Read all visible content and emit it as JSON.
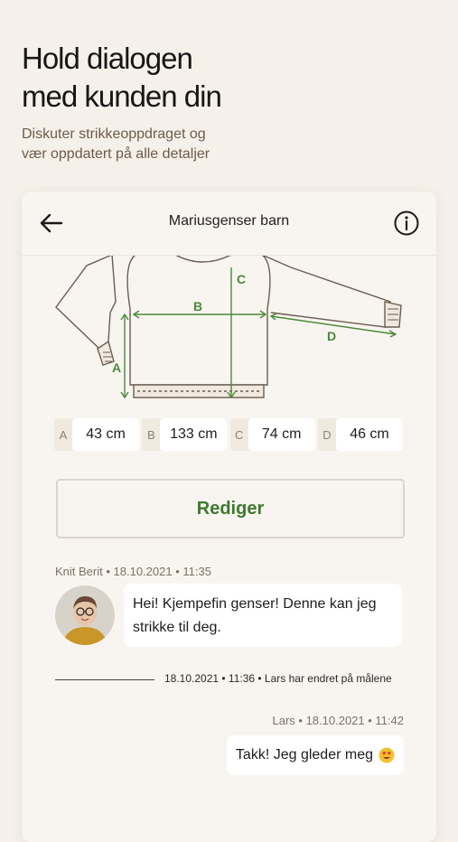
{
  "hero": {
    "title_line1": "Hold dialogen",
    "title_line2": "med kunden din",
    "subtitle_line1": "Diskuter strikkeoppdraget og",
    "subtitle_line2": "vær oppdatert på alle detaljer"
  },
  "header": {
    "back_icon": "arrow-left-icon",
    "title": "Mariusgenser barn",
    "info_icon": "info-icon"
  },
  "diagram": {
    "labels": {
      "a": "A",
      "b": "B",
      "c": "C",
      "d": "D"
    },
    "accent_color": "#4a8a3a"
  },
  "measurements": [
    {
      "letter": "A",
      "value": "43 cm"
    },
    {
      "letter": "B",
      "value": "133 cm"
    },
    {
      "letter": "C",
      "value": "74 cm"
    },
    {
      "letter": "D",
      "value": "46 cm"
    }
  ],
  "edit_button": {
    "label": "Rediger",
    "color": "#3d7a2f"
  },
  "chat": {
    "message1": {
      "meta": "Knit Berit • 18.10.2021 • 11:35",
      "line1": "Hei! Kjempefin genser! Denne kan jeg",
      "line2": "strikke til deg."
    },
    "system_event": "18.10.2021 • 11:36 • Lars har endret på målene",
    "message2": {
      "meta": "Lars • 18.10.2021 • 11:42",
      "text": "Takk! Jeg gleder meg",
      "emoji": "heart-eyes-emoji"
    }
  }
}
